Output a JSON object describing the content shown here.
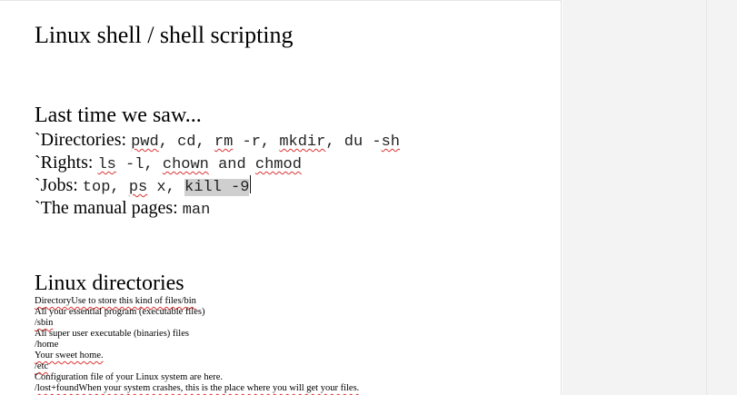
{
  "document": {
    "title": "Linux shell / shell scripting",
    "section1": {
      "heading": "Last time we saw...",
      "lines": [
        {
          "prefix": "`Directories: ",
          "items": [
            "pwd",
            ", cd, ",
            "rm",
            " -r, ",
            "mkdir",
            ", du -",
            "sh"
          ]
        },
        {
          "prefix": "`Rights: ",
          "items": [
            "ls",
            " -l, ",
            "chown",
            " and ",
            "chmod"
          ]
        },
        {
          "prefix": "`Jobs: ",
          "items": [
            "top, ",
            "ps",
            " x, ",
            "kill -9"
          ]
        },
        {
          "prefix": "`The manual pages: ",
          "items": [
            "man"
          ]
        }
      ]
    },
    "section2": {
      "heading": "Linux directories",
      "lines": [
        "DirectoryUse to store this kind of files/bin",
        "All your essential program (executable files)",
        "/sbin",
        "All super user executable (binaries) files",
        "/home",
        "Your sweet home.",
        "/etc",
        "Configuration file of your Linux system are here.",
        "/lost+foundWhen your system crashes, this is the place where you will get your files."
      ]
    }
  }
}
